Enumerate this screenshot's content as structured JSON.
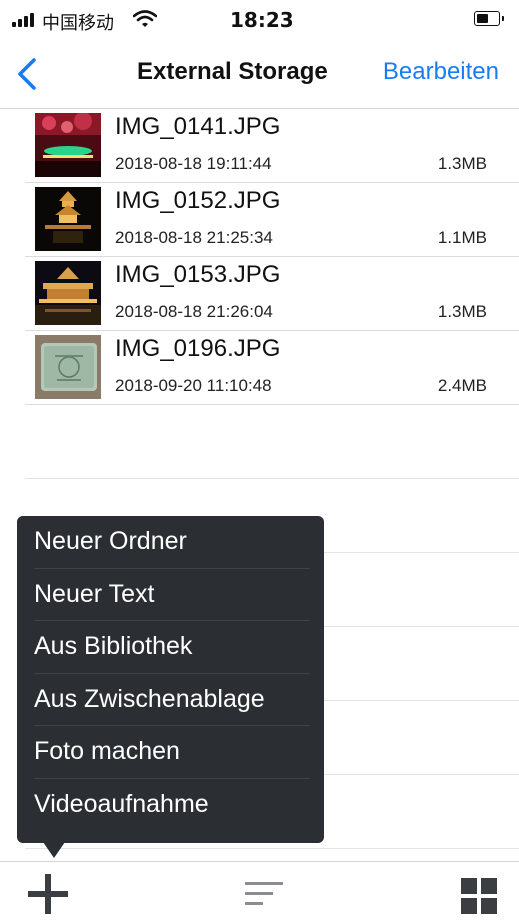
{
  "status_bar": {
    "carrier": "中国移动",
    "time": "18:23",
    "signal_icon": "signal-bars-icon",
    "wifi_icon": "wifi-icon",
    "battery_icon": "battery-icon"
  },
  "nav": {
    "back_icon": "chevron-left-icon",
    "title": "External Storage",
    "edit_label": "Bearbeiten",
    "accent_color": "#1a7cf5"
  },
  "files": [
    {
      "name": "IMG_0141.JPG",
      "date": "2018-08-18 19:11:44",
      "size": "1.3MB"
    },
    {
      "name": "IMG_0152.JPG",
      "date": "2018-08-18 21:25:34",
      "size": "1.1MB"
    },
    {
      "name": "IMG_0153.JPG",
      "date": "2018-08-18 21:26:04",
      "size": "1.3MB"
    },
    {
      "name": "IMG_0196.JPG",
      "date": "2018-09-20 11:10:48",
      "size": "2.4MB"
    }
  ],
  "menu": {
    "items": [
      {
        "label": "Neuer Ordner"
      },
      {
        "label": "Neuer Text"
      },
      {
        "label": "Aus Bibliothek"
      },
      {
        "label": "Aus Zwischenablage"
      },
      {
        "label": "Foto machen"
      },
      {
        "label": "Videoaufnahme"
      }
    ]
  },
  "toolbar": {
    "add_icon": "plus-icon",
    "sort_icon": "sort-lines-icon",
    "grid_icon": "grid-view-icon"
  }
}
